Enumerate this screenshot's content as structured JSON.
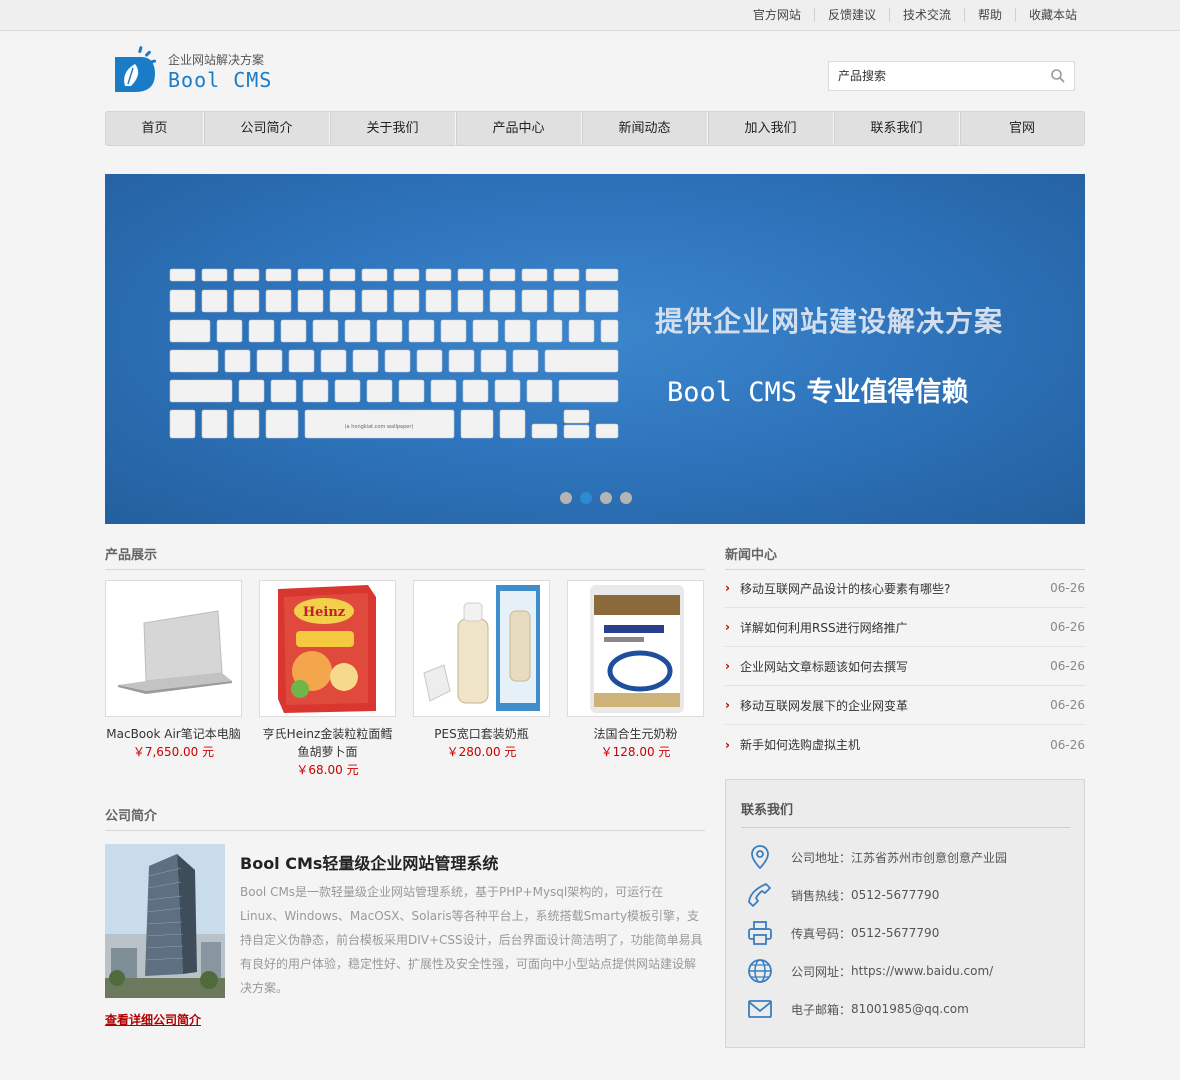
{
  "topbar": {
    "links": [
      "官方网站",
      "反馈建议",
      "技术交流",
      "帮助",
      "收藏本站"
    ]
  },
  "header": {
    "tagline": "企业网站解决方案",
    "logo_text": "Bool CMS",
    "search_placeholder": "产品搜索"
  },
  "nav": {
    "items": [
      "首页",
      "公司简介",
      "关于我们",
      "产品中心",
      "新闻动态",
      "加入我们",
      "联系我们",
      "官网"
    ]
  },
  "banner": {
    "title": "提供企业网站建设解决方案",
    "subtitle_brand": "Bool CMS",
    "subtitle_text": "专业值得信赖",
    "keyboard_caption": "(a hongkiat.com wallpaper)",
    "slide_count": 4,
    "active_slide": 2
  },
  "products": {
    "heading": "产品展示",
    "items": [
      {
        "name": "MacBook Air笔记本电脑",
        "price": "￥7,650.00 元"
      },
      {
        "name": "亨氏Heinz金装粒粒面鳕鱼胡萝卜面",
        "price": "￥68.00 元"
      },
      {
        "name": "PES宽口套装奶瓶",
        "price": "￥280.00 元"
      },
      {
        "name": "法国合生元奶粉",
        "price": "￥128.00 元"
      }
    ]
  },
  "about": {
    "heading": "公司简介",
    "title": "Bool CMs轻量级企业网站管理系统",
    "text": "Bool CMs是一款轻量级企业网站管理系统，基于PHP+Mysql架构的，可运行在Linux、Windows、MacOSX、Solaris等各种平台上，系统搭载Smarty模板引擎，支持自定义伪静态，前台模板采用DIV+CSS设计，后台界面设计简洁明了，功能简单易具有良好的用户体验，稳定性好、扩展性及安全性强，可面向中小型站点提供网站建设解决方案。",
    "more_link": "查看详细公司简介"
  },
  "news": {
    "heading": "新闻中心",
    "items": [
      {
        "title": "移动互联网产品设计的核心要素有哪些?",
        "date": "06-26"
      },
      {
        "title": "详解如何利用RSS进行网络推广",
        "date": "06-26"
      },
      {
        "title": "企业网站文章标题该如何去撰写",
        "date": "06-26"
      },
      {
        "title": "移动互联网发展下的企业网变革",
        "date": "06-26"
      },
      {
        "title": "新手如何选购虚拟主机",
        "date": "06-26"
      }
    ]
  },
  "contact": {
    "heading": "联系我们",
    "rows": [
      {
        "icon": "location-icon",
        "label": "公司地址：",
        "value": "江苏省苏州市创意创意产业园"
      },
      {
        "icon": "phone-icon",
        "label": "销售热线：",
        "value": "0512-5677790"
      },
      {
        "icon": "printer-icon",
        "label": "传真号码：",
        "value": "0512-5677790"
      },
      {
        "icon": "globe-icon",
        "label": "公司网址：",
        "value": "https://www.baidu.com/"
      },
      {
        "icon": "mail-icon",
        "label": "电子邮箱：",
        "value": "81001985@qq.com"
      }
    ]
  },
  "colors": {
    "brand_blue": "#1a7bc6",
    "banner_blue": "#2f75bd",
    "price_red": "#cc0000",
    "link_red": "#b00000"
  }
}
